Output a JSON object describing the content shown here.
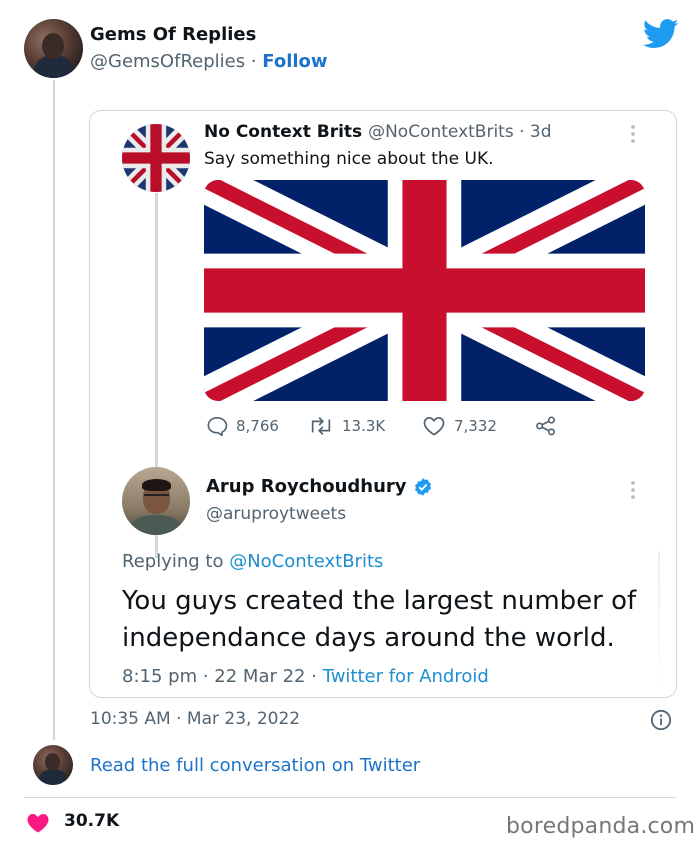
{
  "embed": {
    "account_name": "Gems Of Replies",
    "account_handle": "@GemsOfReplies",
    "separator": " · ",
    "follow_label": "Follow",
    "brand_color": "#1d9bf0",
    "icons": {
      "logo": "twitter-bird-icon",
      "info": "info-icon",
      "like": "heart-icon"
    }
  },
  "quoted_tweet": {
    "name": "No Context Brits",
    "handle": "@NoContextBrits",
    "age": " · 3d",
    "text": "Say something nice about the UK.",
    "image": "union-jack-flag",
    "stats": {
      "replies": "8,766",
      "retweets": "13.3K",
      "likes": "7,332"
    },
    "icons": [
      "reply-icon",
      "retweet-icon",
      "like-icon",
      "share-icon"
    ]
  },
  "reply_tweet": {
    "name": "Arup Roychoudhury",
    "handle": "@aruproytweets",
    "verified": true,
    "replying_prefix": "Replying to ",
    "replying_to": "@NoContextBrits",
    "text": "You guys created the largest number of independance days around the world.",
    "time": "8:15 pm",
    "date": "22 Mar 22",
    "client": "Twitter for Android",
    "meta_sep": " · "
  },
  "footer": {
    "timestamp": "10:35 AM · Mar 23, 2022",
    "read_more": "Read the full conversation on Twitter",
    "like_count": "30.7K",
    "like_color": "#f91880",
    "watermark": "boredpanda.com"
  }
}
